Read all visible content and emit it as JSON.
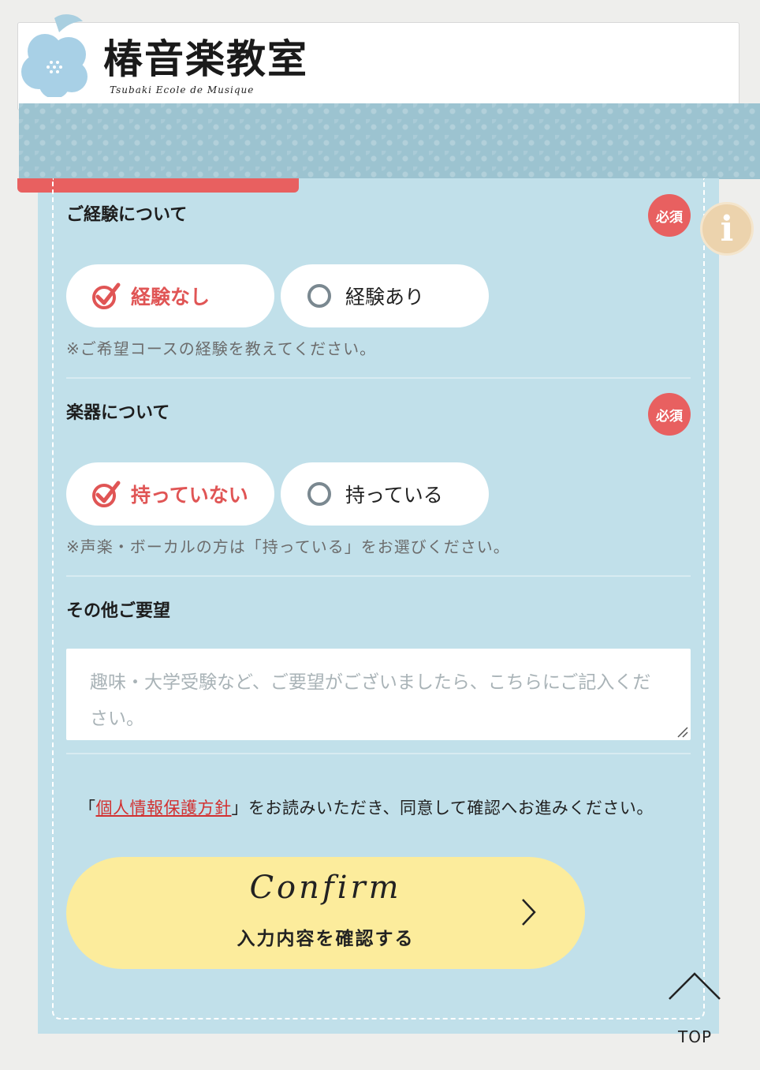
{
  "header": {
    "logo_title": "椿音楽教室",
    "logo_subtitle": "Tsubaki Ecole de Musique"
  },
  "experience": {
    "label": "ご経験について",
    "required": "必須",
    "options": [
      "経験なし",
      "経験あり"
    ],
    "selected": "経験なし",
    "note": "※ご希望コースの経験を教えてください。"
  },
  "instrument": {
    "label": "楽器について",
    "required": "必須",
    "options": [
      "持っていない",
      "持っている"
    ],
    "selected": "持っていない",
    "note": "※声楽・ボーカルの方は「持っている」をお選びください。"
  },
  "requests": {
    "label": "その他ご要望",
    "placeholder": "趣味・大学受験など、ご要望がございましたら、こちらにご記入ください。"
  },
  "policy": {
    "open_bracket": "「",
    "link_text": "個人情報保護方針",
    "rest": "」をお読みいただき、同意して確認へお進みください。"
  },
  "confirm": {
    "english": "Confirm",
    "japanese": "入力内容を確認する"
  },
  "top_button": {
    "label": "TOP"
  },
  "colors": {
    "panel": "#c1e0ea",
    "accent_red": "#e86060",
    "button_yellow": "#fcec9c",
    "info_beige": "#ecd3ad"
  }
}
